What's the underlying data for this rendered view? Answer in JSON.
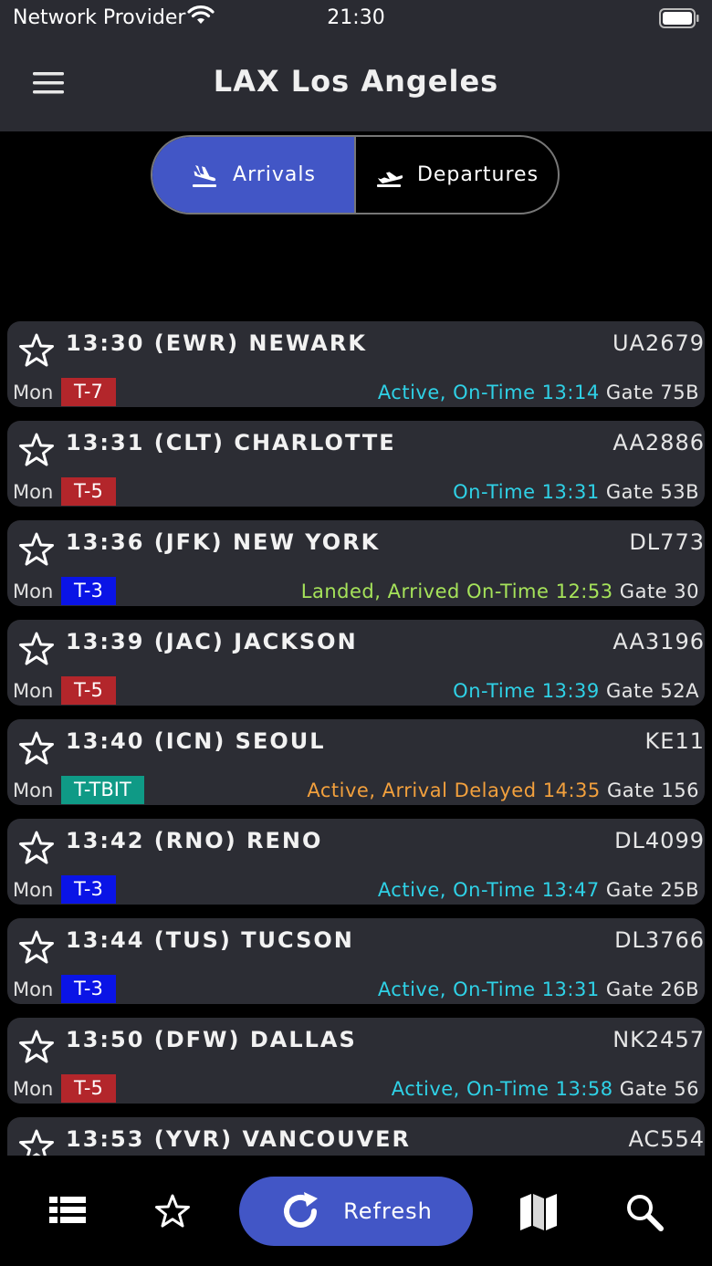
{
  "status_bar": {
    "carrier": "Network Provider",
    "time": "21:30"
  },
  "header": {
    "title": "LAX Los Angeles",
    "menu_icon": "hamburger-menu-icon"
  },
  "segments": {
    "arrivals": "Arrivals",
    "departures": "Departures",
    "active": "arrivals"
  },
  "colors": {
    "accent": "#4256c6",
    "card_bg": "#2c2d34",
    "status_cyan": "#2fd1e6",
    "status_green": "#a6e35a",
    "status_orange": "#f2a03d",
    "terminal_red": "#b3262b",
    "terminal_blue": "#0a14e6",
    "terminal_teal": "#0f9a86"
  },
  "flights": [
    {
      "title": "13:30 (EWR) NEWARK",
      "flight": "UA2679",
      "day": "Mon",
      "terminal": "T-7",
      "terminal_color": "#b3262b",
      "status": "Active, On-Time 13:14",
      "status_color": "#2fd1e6",
      "gate": "Gate 75B"
    },
    {
      "title": "13:31 (CLT) CHARLOTTE",
      "flight": "AA2886",
      "day": "Mon",
      "terminal": "T-5",
      "terminal_color": "#b3262b",
      "status": "On-Time 13:31",
      "status_color": "#2fd1e6",
      "gate": "Gate 53B"
    },
    {
      "title": "13:36 (JFK) NEW YORK",
      "flight": "DL773",
      "day": "Mon",
      "terminal": "T-3",
      "terminal_color": "#0a14e6",
      "status": "Landed, Arrived On-Time 12:53",
      "status_color": "#a6e35a",
      "gate": "Gate 30"
    },
    {
      "title": "13:39 (JAC) JACKSON",
      "flight": "AA3196",
      "day": "Mon",
      "terminal": "T-5",
      "terminal_color": "#b3262b",
      "status": "On-Time 13:39",
      "status_color": "#2fd1e6",
      "gate": "Gate 52A"
    },
    {
      "title": "13:40 (ICN) SEOUL",
      "flight": "KE11",
      "day": "Mon",
      "terminal": "T-TBIT",
      "terminal_color": "#0f9a86",
      "status": "Active, Arrival Delayed 14:35",
      "status_color": "#f2a03d",
      "gate": "Gate 156"
    },
    {
      "title": "13:42 (RNO) RENO",
      "flight": "DL4099",
      "day": "Mon",
      "terminal": "T-3",
      "terminal_color": "#0a14e6",
      "status": "Active, On-Time 13:47",
      "status_color": "#2fd1e6",
      "gate": "Gate 25B"
    },
    {
      "title": "13:44 (TUS) TUCSON",
      "flight": "DL3766",
      "day": "Mon",
      "terminal": "T-3",
      "terminal_color": "#0a14e6",
      "status": "Active, On-Time 13:31",
      "status_color": "#2fd1e6",
      "gate": "Gate 26B"
    },
    {
      "title": "13:50 (DFW) DALLAS",
      "flight": "NK2457",
      "day": "Mon",
      "terminal": "T-5",
      "terminal_color": "#b3262b",
      "status": "Active, On-Time 13:58",
      "status_color": "#2fd1e6",
      "gate": "Gate 56"
    },
    {
      "title": "13:53 (YVR) VANCOUVER",
      "flight": "AC554",
      "day": "",
      "terminal": "",
      "terminal_color": "#b3262b",
      "status": "",
      "status_color": "#2fd1e6",
      "gate": ""
    }
  ],
  "tab_bar": {
    "refresh_label": "Refresh",
    "icons": [
      "list-icon",
      "star-icon",
      "refresh-icon",
      "map-icon",
      "search-icon"
    ]
  }
}
